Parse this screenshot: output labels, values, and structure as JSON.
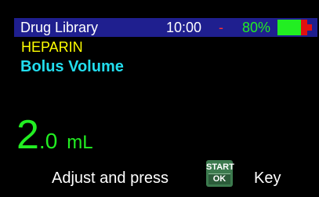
{
  "status_bar": {
    "title": "Drug Library",
    "time": "10:00",
    "separator": "-",
    "battery_percent": "80%",
    "battery_level": 0.8,
    "battery_icon": "battery-icon"
  },
  "drug": {
    "name": "HEPARIN"
  },
  "parameter": {
    "label": "Bolus Volume",
    "value_integer": "2",
    "value_decimal": ".0",
    "unit": "mL"
  },
  "prompt": {
    "before": "Adjust and press",
    "key_top": "START",
    "key_bottom": "OK",
    "after": "Key"
  },
  "colors": {
    "background": "#000000",
    "status_bar": "#1f1f8f",
    "drug_name": "#ffff00",
    "parameter_label": "#22ddee",
    "value": "#22ee22",
    "battery_fill": "#22ee22",
    "battery_empty": "#e01010",
    "separator": "#ff3030",
    "start_key": "#3c7a4e"
  }
}
